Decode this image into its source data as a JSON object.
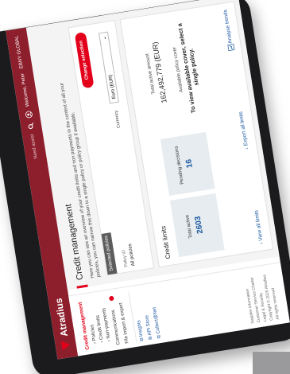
{
  "header": {
    "brand": "Atradius",
    "search_hint": "Need assist",
    "user_greeting": "Welcome, Peter",
    "company": "EBNY GLOBAL"
  },
  "sidebar": {
    "section_title": "Credit management",
    "sub_items": [
      "Policies",
      "Credit limits",
      "Non-payments"
    ],
    "items": [
      {
        "label": "Communications",
        "badge": true
      },
      {
        "label": "File import & export",
        "badge": false
      }
    ],
    "links": [
      "Insights",
      "API Store",
      "Collect@Net"
    ],
    "footer": [
      "Supplier information",
      "Customer Service Charter",
      "Legal & Security",
      "Copyright © 2020 Atradius",
      "All rights reserved"
    ]
  },
  "main": {
    "title": "Credit management",
    "intro": "Here you can see an overview of your credit limits and non payments in the context of all your policies, you can narrow this down to a single policy or policy group if available.",
    "policies": {
      "tab_label": "Selected policies",
      "policy_label": "Policy ID",
      "policy_value": "All policies",
      "change_button": "Change selection",
      "currency_label": "Currency",
      "currency_value": "Euro (EUR)"
    },
    "limits": {
      "title": "Credit limits",
      "total_active_label": "Total active",
      "total_active_value": "2603",
      "pending_label": "Pending decisions",
      "pending_value": "16",
      "total_amount_label": "Total active amount",
      "total_amount_value": "162,492,779 (EUR)",
      "cover_label": "Available policy cover",
      "cover_message": "To view available cover, select a single policy.",
      "view_all": "View all limits",
      "export_all": "Export all limits",
      "analyse": "Analyse trends"
    }
  }
}
